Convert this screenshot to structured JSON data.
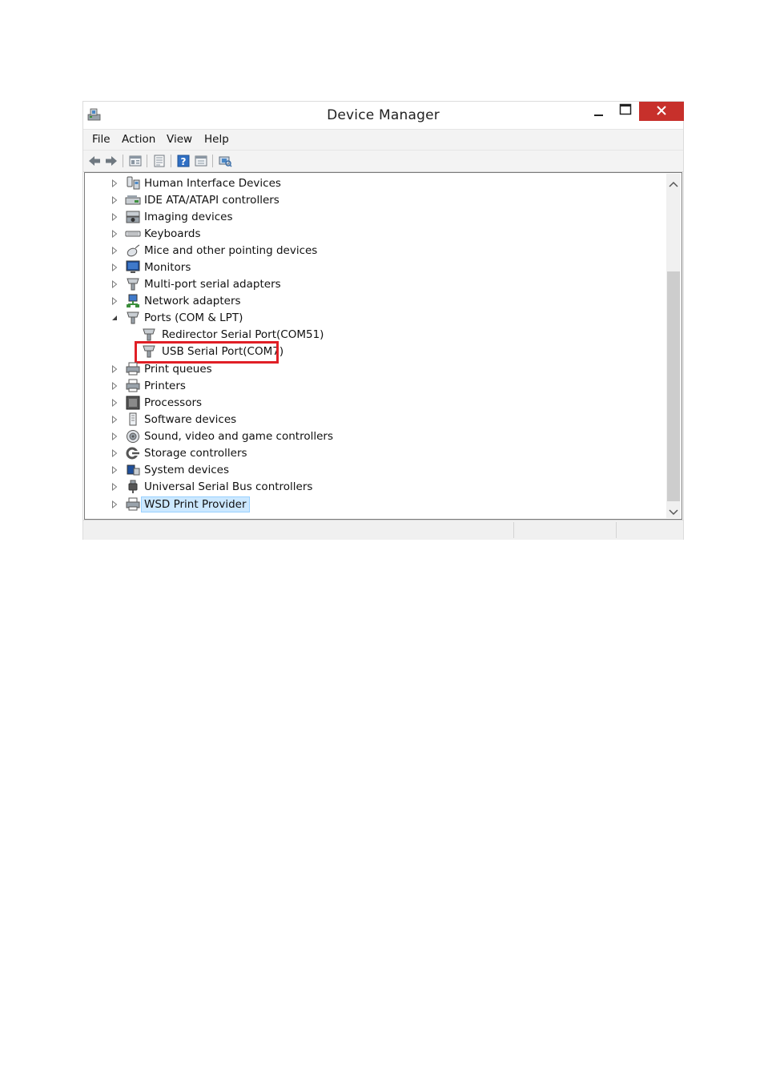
{
  "window": {
    "title": "Device Manager",
    "controls": {
      "minimize": "minimize-icon",
      "maximize": "maximize-icon",
      "close": "close-icon"
    },
    "close_color": "#c7302b"
  },
  "menu": [
    "File",
    "Action",
    "View",
    "Help"
  ],
  "toolbar": [
    "back-arrow-icon",
    "forward-arrow-icon",
    "show-hide-console-tree-icon",
    "properties-icon",
    "help-icon",
    "update-driver-icon",
    "scan-hardware-icon"
  ],
  "tree": [
    {
      "label": "Human Interface Devices",
      "icon": "hid-icon",
      "expanded": false
    },
    {
      "label": "IDE ATA/ATAPI controllers",
      "icon": "ide-controller-icon",
      "expanded": false
    },
    {
      "label": "Imaging devices",
      "icon": "camera-icon",
      "expanded": false
    },
    {
      "label": "Keyboards",
      "icon": "keyboard-icon",
      "expanded": false
    },
    {
      "label": "Mice and other pointing devices",
      "icon": "mouse-icon",
      "expanded": false
    },
    {
      "label": "Monitors",
      "icon": "monitor-icon",
      "expanded": false
    },
    {
      "label": "Multi-port serial adapters",
      "icon": "serial-adapter-icon",
      "expanded": false
    },
    {
      "label": "Network adapters",
      "icon": "network-adapter-icon",
      "expanded": false
    },
    {
      "label": "Ports (COM & LPT)",
      "icon": "port-icon",
      "expanded": true,
      "children": [
        {
          "label": "Redirector Serial Port(COM51)",
          "icon": "port-icon"
        },
        {
          "label": "USB Serial Port(COM7)",
          "icon": "port-icon",
          "highlighted": true
        }
      ]
    },
    {
      "label": "Print queues",
      "icon": "printer-icon",
      "expanded": false
    },
    {
      "label": "Printers",
      "icon": "printer-icon",
      "expanded": false
    },
    {
      "label": "Processors",
      "icon": "processor-icon",
      "expanded": false
    },
    {
      "label": "Software devices",
      "icon": "software-device-icon",
      "expanded": false
    },
    {
      "label": "Sound, video and game controllers",
      "icon": "speaker-icon",
      "expanded": false
    },
    {
      "label": "Storage controllers",
      "icon": "storage-controller-icon",
      "expanded": false
    },
    {
      "label": "System devices",
      "icon": "system-device-icon",
      "expanded": false
    },
    {
      "label": "Universal Serial Bus controllers",
      "icon": "usb-icon",
      "expanded": false
    },
    {
      "label": "WSD Print Provider",
      "icon": "printer-icon",
      "expanded": false,
      "selected": true
    }
  ],
  "highlight_color": "#e01f26",
  "selection_color": "#cce8ff"
}
